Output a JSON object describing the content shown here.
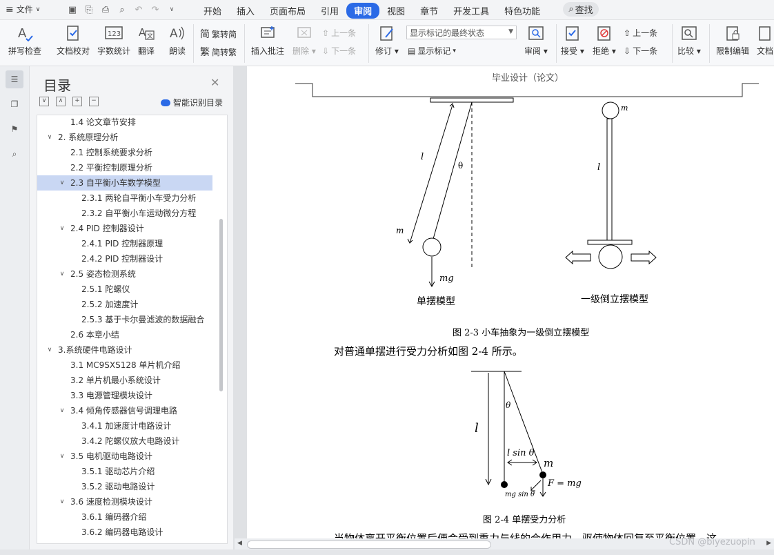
{
  "menubar": {
    "file_label": "文件",
    "tabs": [
      "开始",
      "插入",
      "页面布局",
      "引用",
      "审阅",
      "视图",
      "章节",
      "开发工具",
      "特色功能"
    ],
    "active_tab": "审阅",
    "search_label": "查找"
  },
  "ribbon": {
    "spell_check": "拼写检查",
    "doc_proof": "文档校对",
    "word_count": "字数统计",
    "translate": "翻译",
    "read_aloud": "朗读",
    "trad_to_simp": "繁转简",
    "simp_to_trad": "简转繁",
    "insert_comment": "插入批注",
    "delete": "删除",
    "prev_comment": "上一条",
    "next_comment": "下一条",
    "revise": "修订",
    "markup_select": "显示标记的最终状态",
    "show_markup": "显示标记",
    "review": "审阅",
    "accept": "接受",
    "reject": "拒绝",
    "prev_change": "上一条",
    "next_change": "下一条",
    "compare": "比较",
    "restrict_edit": "限制编辑",
    "doc_permission": "文档"
  },
  "toc": {
    "title": "目录",
    "smart_label": "智能识别目录",
    "items": [
      {
        "text": "1.4 论文章节安排",
        "level": 2,
        "twisty": ""
      },
      {
        "text": "2. 系统原理分析",
        "level": 1,
        "twisty": "v"
      },
      {
        "text": "2.1 控制系统要求分析",
        "level": 2,
        "twisty": ""
      },
      {
        "text": "2.2 平衡控制原理分析",
        "level": 2,
        "twisty": ""
      },
      {
        "text": "2.3 自平衡小车数学模型",
        "level": 2,
        "twisty": "v",
        "selected": true
      },
      {
        "text": "2.3.1 两轮自平衡小车受力分析",
        "level": 3,
        "twisty": ""
      },
      {
        "text": "2.3.2 自平衡小车运动微分方程",
        "level": 3,
        "twisty": ""
      },
      {
        "text": "2.4 PID 控制器设计",
        "level": 2,
        "twisty": "v"
      },
      {
        "text": "2.4.1 PID 控制器原理",
        "level": 3,
        "twisty": ""
      },
      {
        "text": "2.4.2 PID 控制器设计",
        "level": 3,
        "twisty": ""
      },
      {
        "text": "2.5 姿态检测系统",
        "level": 2,
        "twisty": "v"
      },
      {
        "text": "2.5.1 陀螺仪",
        "level": 3,
        "twisty": ""
      },
      {
        "text": "2.5.2 加速度计",
        "level": 3,
        "twisty": ""
      },
      {
        "text": "2.5.3 基于卡尔曼滤波的数据融合",
        "level": 3,
        "twisty": ""
      },
      {
        "text": "2.6 本章小结",
        "level": 2,
        "twisty": ""
      },
      {
        "text": "3.系统硬件电路设计",
        "level": 1,
        "twisty": "v"
      },
      {
        "text": "3.1 MC9SXS128 单片机介绍",
        "level": 2,
        "twisty": ""
      },
      {
        "text": "3.2 单片机最小系统设计",
        "level": 2,
        "twisty": ""
      },
      {
        "text": "3.3  电源管理模块设计",
        "level": 2,
        "twisty": ""
      },
      {
        "text": "3.4 倾角传感器信号调理电路",
        "level": 2,
        "twisty": "v"
      },
      {
        "text": "3.4.1 加速度计电路设计",
        "level": 3,
        "twisty": ""
      },
      {
        "text": "3.4.2 陀螺仪放大电路设计",
        "level": 3,
        "twisty": ""
      },
      {
        "text": "3.5 电机驱动电路设计",
        "level": 2,
        "twisty": "v"
      },
      {
        "text": "3.5.1 驱动芯片介绍",
        "level": 3,
        "twisty": ""
      },
      {
        "text": "3.5.2  驱动电路设计",
        "level": 3,
        "twisty": ""
      },
      {
        "text": "3.6 速度检测模块设计",
        "level": 2,
        "twisty": "v"
      },
      {
        "text": "3.6.1 编码器介绍",
        "level": 3,
        "twisty": ""
      },
      {
        "text": "3.6.2  编码器电路设计",
        "level": 3,
        "twisty": ""
      }
    ]
  },
  "document": {
    "header": "毕业设计（论文）",
    "fig1": {
      "left_label": "单摆模型",
      "right_label": "一级倒立摆模型",
      "caption": "图 2-3  小车抽象为一级倒立摆模型",
      "l": "l",
      "theta": "θ",
      "m": "m",
      "mg": "mg"
    },
    "para1": "对普通单摆进行受力分析如图 2-4 所示。",
    "fig2": {
      "caption": "图 2-4  单摆受力分析",
      "l": "l",
      "theta": "θ",
      "lsin": "l sin θ",
      "m": "m",
      "force": "F = mg",
      "mgsin": "mg sin θ"
    },
    "para2": "当物体离开平衡位置后便会受到重力与线的合作用力，驱使物体回复至平衡位置，这"
  },
  "watermark": "CSDN @biyezuopin"
}
